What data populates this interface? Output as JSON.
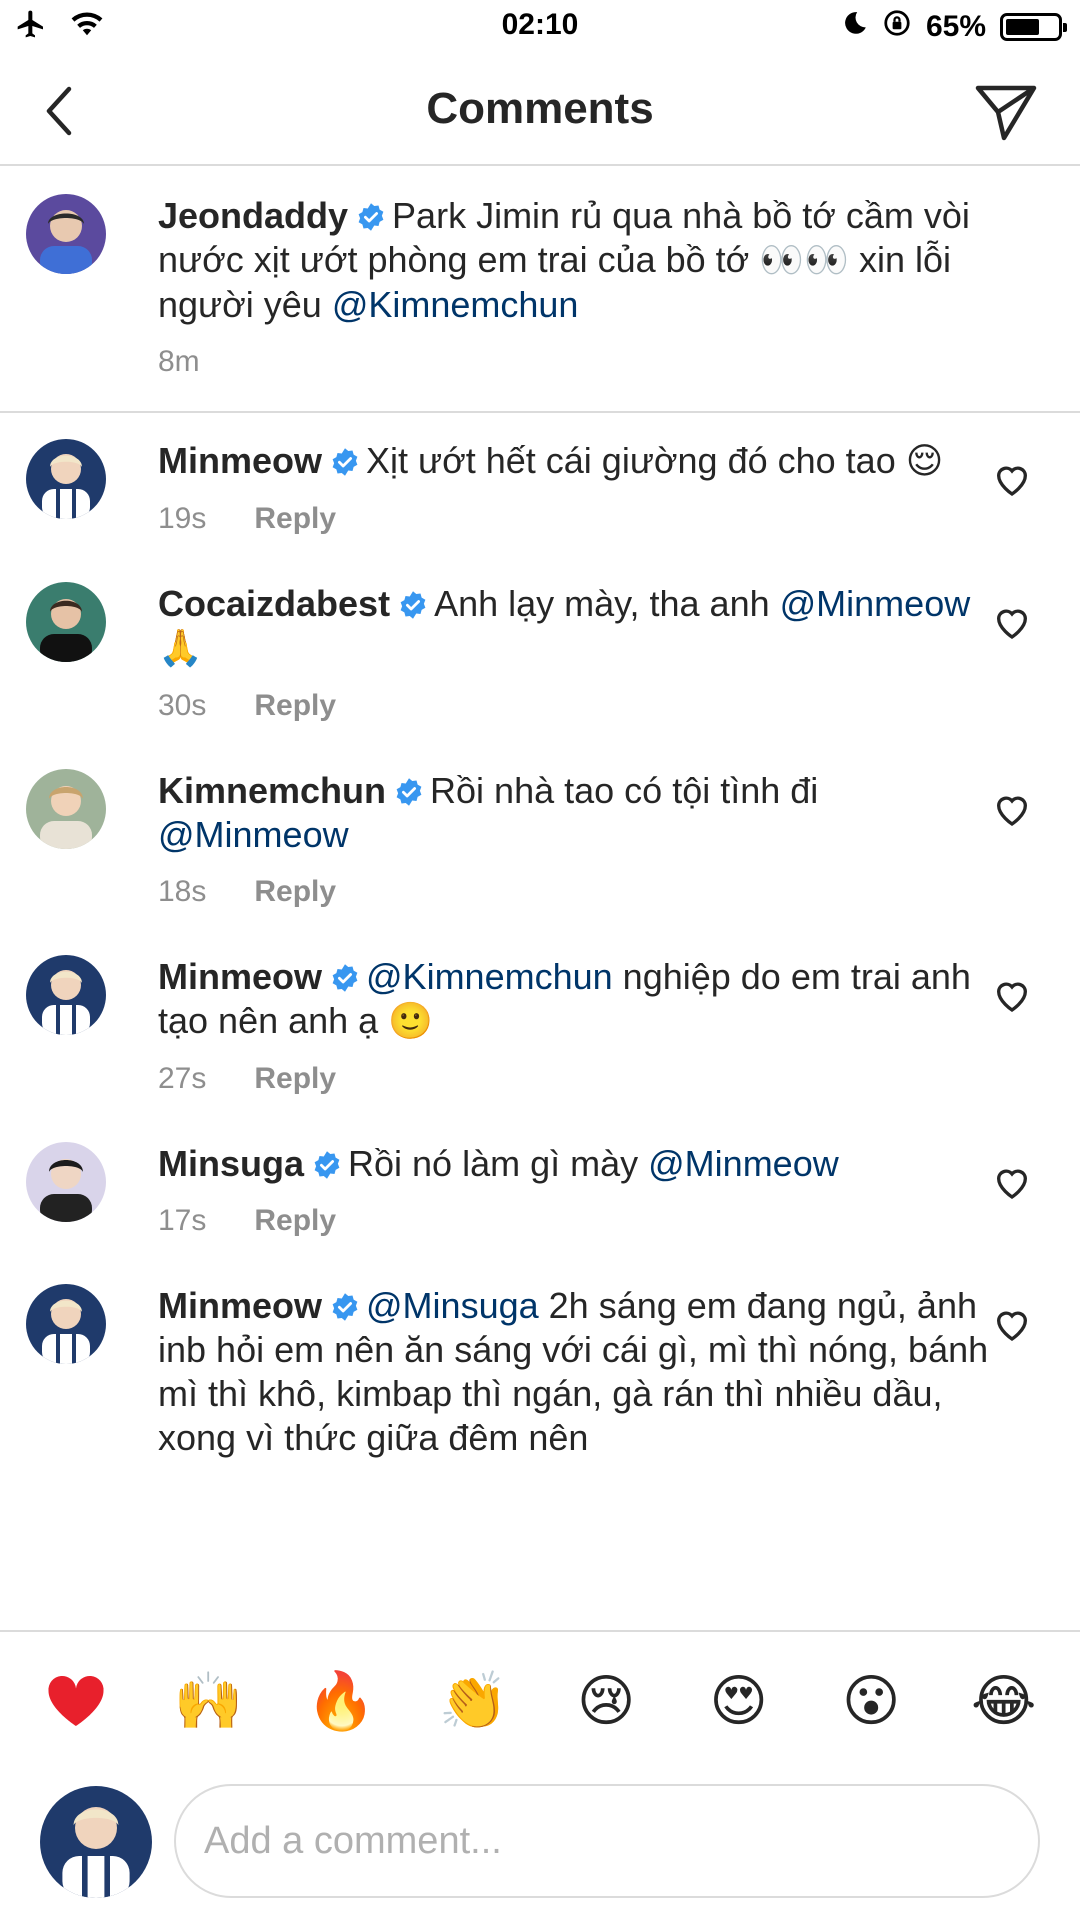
{
  "status_bar": {
    "time": "02:10",
    "battery": "65%",
    "battery_level": 0.65,
    "icons": [
      "airplane-icon",
      "wifi-icon",
      "moon-icon",
      "rotation-lock-icon",
      "battery-icon"
    ]
  },
  "header": {
    "title": "Comments",
    "back_icon": "chevron-left-icon",
    "share_icon": "paper-plane-icon"
  },
  "caption": {
    "username": "Jeondaddy",
    "verified": true,
    "text": "Park Jimin rủ qua nhà bồ tớ cầm vòi nước xịt ướt phòng em trai của bồ tớ",
    "emoji": "👀👀",
    "text_after": "xin lỗi người yêu",
    "mention": "@Kimnemchun",
    "time": "8m"
  },
  "comments": [
    {
      "username": "Minmeow",
      "text": "Xịt ướt hết cái giường đó cho tao",
      "mention": "",
      "text_after": "",
      "emoji": "😌",
      "time": "19s",
      "reply": "Reply"
    },
    {
      "username": "Cocaizdabest",
      "text": "Anh lạy mày, tha anh",
      "mention": "@Minmeow",
      "text_after": "",
      "emoji": "🙏",
      "time": "30s",
      "reply": "Reply"
    },
    {
      "username": "Kimnemchun",
      "text": "Rồi nhà tao có tội tình đi",
      "mention": "@Minmeow",
      "text_after": "",
      "emoji": "",
      "time": "18s",
      "reply": "Reply"
    },
    {
      "username": "Minmeow",
      "text": "",
      "mention": "@Kimnemchun",
      "text_after": "nghiệp do em trai anh tạo nên anh ạ",
      "emoji": "🙂",
      "time": "27s",
      "reply": "Reply"
    },
    {
      "username": "Minsuga",
      "text": "Rồi nó làm gì mày",
      "mention": "@Minmeow",
      "text_after": "",
      "emoji": "",
      "time": "17s",
      "reply": "Reply"
    },
    {
      "username": "Minmeow",
      "text": "",
      "mention": "@Minsuga",
      "text_after": "2h sáng em đang ngủ, ảnh inb hỏi em nên ăn sáng với cái gì, mì thì nóng, bánh mì thì khô, kimbap thì ngán, gà rán thì nhiều dầu, xong vì thức giữa đêm nên",
      "emoji": "",
      "time": "",
      "reply": ""
    }
  ],
  "reactions": [
    "❤️",
    "🙌",
    "🔥",
    "👏",
    "😢",
    "😍",
    "😮",
    "😂"
  ],
  "input": {
    "placeholder": "Add a comment..."
  },
  "colors": {
    "text": "#262626",
    "mention": "#003569",
    "meta": "#8e8e8e",
    "verified": "#3897f0",
    "divider": "#dbdbdb"
  }
}
